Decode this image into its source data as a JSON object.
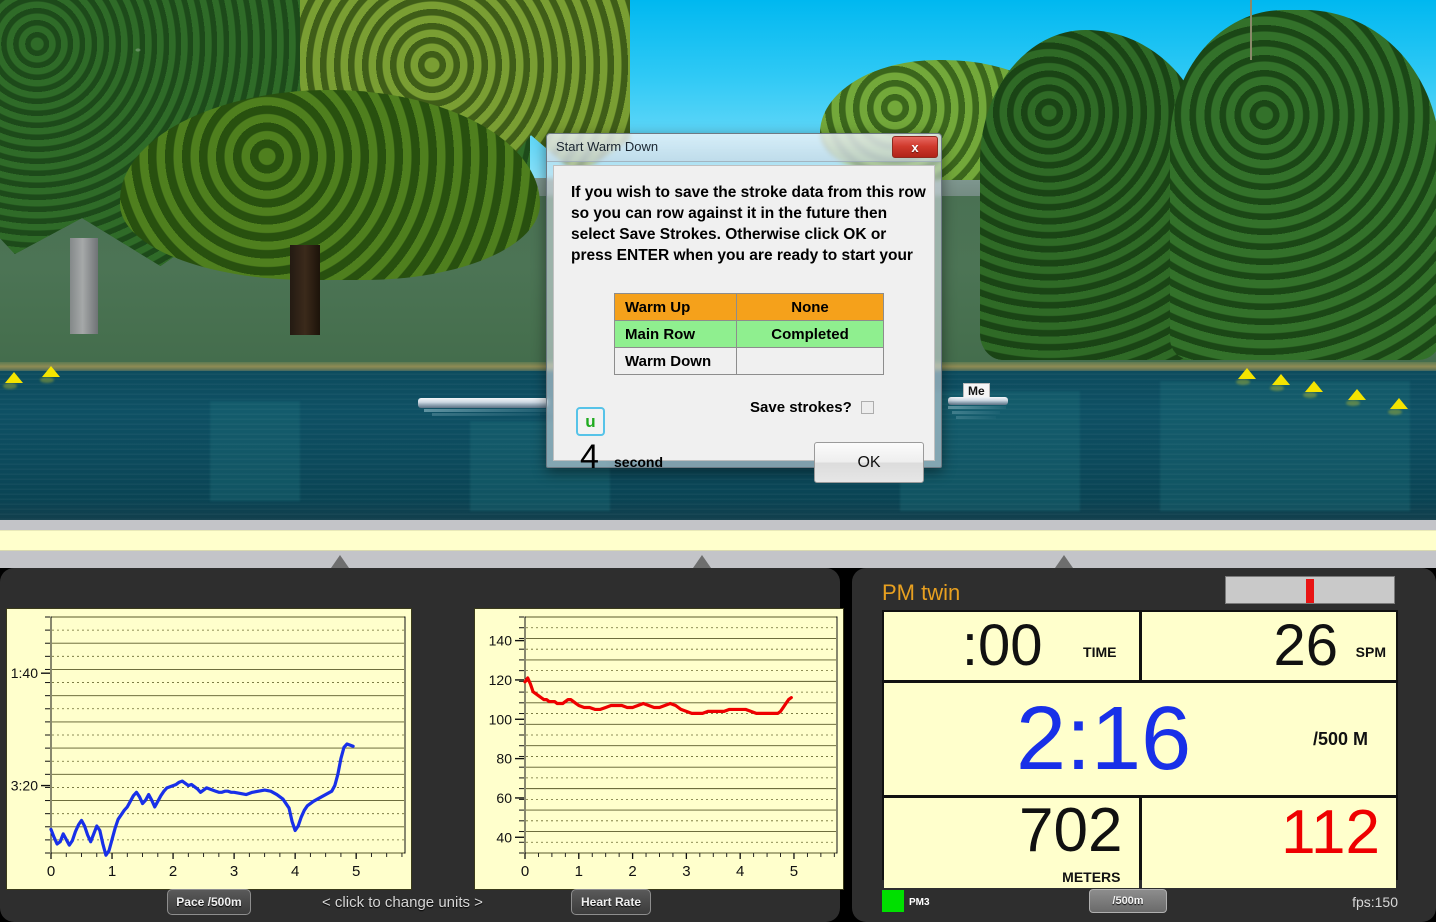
{
  "scene": {
    "boats": [
      {
        "name": "opponent-boat",
        "label": ""
      },
      {
        "name": "my-boat",
        "label": "Me"
      }
    ]
  },
  "dialog": {
    "title": "Start Warm Down",
    "close_label": "x",
    "message": "If you wish to save the stroke data from this row so you can row against it in the future then select Save Strokes.  Otherwise click OK or press ENTER when you are ready to start your",
    "status_rows": [
      {
        "label": "Warm Up",
        "value": "None"
      },
      {
        "label": "Main Row",
        "value": "Completed"
      },
      {
        "label": "Warm Down",
        "value": ""
      }
    ],
    "save_strokes_label": "Save strokes?",
    "save_strokes_checked": false,
    "units_button_label": "u",
    "countdown_value": "4",
    "countdown_unit": "second",
    "ok_label": "OK"
  },
  "left_panel": {
    "pace_button": "Pace /500m",
    "hint": "<  click to change units  >",
    "hr_button": "Heart Rate"
  },
  "monitor": {
    "title": "PM twin",
    "time_value": ":00",
    "time_unit": "TIME",
    "spm_value": "26",
    "spm_unit": "SPM",
    "pace_value": "2:16",
    "pace_unit": "/500 M",
    "meters_value": "702",
    "meters_unit": "METERS",
    "heart_rate_value": "112",
    "device_label": "PM3",
    "units_button": "/500m",
    "fps": "fps:150",
    "colors": {
      "pace": "#1830e8",
      "heart_rate": "#ee0000",
      "title": "#e8a020",
      "screen": "#ffffcc",
      "led": "#00e000",
      "indicator": "#e81414"
    }
  },
  "chart_data": [
    {
      "type": "line",
      "name": "pace-chart",
      "title": "",
      "xlabel": "",
      "ylabel": "Pace /500m",
      "series_color": "#1830e8",
      "xlim": [
        0,
        5.8
      ],
      "xticks": [
        0,
        1,
        2,
        3,
        4,
        5
      ],
      "xticklabels": [
        "0",
        "1",
        "2",
        "3",
        "4",
        "5"
      ],
      "ylim_labels": [
        "1:40",
        "3:20"
      ],
      "yticks_labeled": [
        100,
        200
      ],
      "ylim": [
        50,
        260
      ],
      "y_inverted": true,
      "grid": true,
      "x": [
        0.0,
        0.05,
        0.1,
        0.15,
        0.2,
        0.25,
        0.3,
        0.35,
        0.4,
        0.45,
        0.5,
        0.55,
        0.6,
        0.65,
        0.7,
        0.75,
        0.8,
        0.85,
        0.9,
        0.95,
        1.0,
        1.05,
        1.1,
        1.15,
        1.2,
        1.25,
        1.3,
        1.35,
        1.4,
        1.45,
        1.5,
        1.55,
        1.6,
        1.65,
        1.7,
        1.75,
        1.8,
        1.85,
        1.9,
        1.95,
        2.0,
        2.05,
        2.1,
        2.15,
        2.2,
        2.25,
        2.3,
        2.35,
        2.4,
        2.45,
        2.5,
        2.55,
        2.6,
        2.65,
        2.7,
        2.75,
        2.8,
        2.85,
        2.9,
        2.95,
        3.0,
        3.1,
        3.2,
        3.3,
        3.4,
        3.5,
        3.6,
        3.7,
        3.8,
        3.9,
        3.95,
        4.0,
        4.05,
        4.1,
        4.15,
        4.2,
        4.3,
        4.4,
        4.5,
        4.6,
        4.65,
        4.7,
        4.75,
        4.8,
        4.85,
        4.9,
        4.95
      ],
      "y": [
        239,
        246,
        252,
        250,
        243,
        248,
        253,
        249,
        241,
        235,
        231,
        236,
        244,
        250,
        243,
        236,
        240,
        252,
        262,
        258,
        248,
        238,
        230,
        226,
        222,
        219,
        214,
        209,
        206,
        210,
        216,
        213,
        208,
        213,
        219,
        214,
        209,
        205,
        202,
        201,
        200,
        199,
        197,
        196,
        198,
        200,
        199,
        201,
        203,
        206,
        204,
        202,
        203,
        204,
        205,
        206,
        206,
        205,
        205,
        206,
        206,
        207,
        208,
        206,
        205,
        204,
        205,
        208,
        212,
        220,
        232,
        240,
        236,
        228,
        222,
        218,
        214,
        211,
        208,
        205,
        200,
        190,
        176,
        166,
        163,
        164,
        165
      ],
      "values_unit": "seconds per 500m"
    },
    {
      "type": "line",
      "name": "heart-rate-chart",
      "title": "",
      "xlabel": "",
      "ylabel": "Heart Rate",
      "series_color": "#ee0000",
      "xlim": [
        0,
        5.8
      ],
      "xticks": [
        0,
        1,
        2,
        3,
        4,
        5
      ],
      "xticklabels": [
        "0",
        "1",
        "2",
        "3",
        "4",
        "5"
      ],
      "ylim": [
        32,
        152
      ],
      "yticks": [
        40,
        60,
        80,
        100,
        120,
        140
      ],
      "yticklabels": [
        "40",
        "60",
        "80",
        "100",
        "120",
        "140"
      ],
      "grid": true,
      "x": [
        0.0,
        0.05,
        0.1,
        0.15,
        0.2,
        0.25,
        0.3,
        0.35,
        0.4,
        0.45,
        0.5,
        0.55,
        0.6,
        0.65,
        0.7,
        0.75,
        0.8,
        0.85,
        0.9,
        0.95,
        1.0,
        1.1,
        1.2,
        1.3,
        1.4,
        1.5,
        1.6,
        1.7,
        1.8,
        1.9,
        2.0,
        2.1,
        2.2,
        2.3,
        2.4,
        2.5,
        2.6,
        2.7,
        2.8,
        2.9,
        3.0,
        3.1,
        3.2,
        3.3,
        3.4,
        3.5,
        3.6,
        3.7,
        3.8,
        3.9,
        4.0,
        4.1,
        4.2,
        4.3,
        4.4,
        4.5,
        4.6,
        4.7,
        4.75,
        4.8,
        4.85,
        4.9,
        4.95
      ],
      "y": [
        119,
        121,
        118,
        114,
        113,
        112,
        111,
        110,
        110,
        109,
        109,
        109,
        108,
        108,
        108,
        109,
        110,
        110,
        109,
        108,
        107,
        106,
        106,
        105,
        105,
        106,
        107,
        107,
        107,
        106,
        106,
        107,
        108,
        107,
        106,
        106,
        107,
        108,
        107,
        105,
        104,
        103,
        103,
        103,
        104,
        104,
        104,
        104,
        105,
        105,
        105,
        105,
        104,
        103,
        103,
        103,
        103,
        103,
        104,
        106,
        108,
        110,
        111
      ],
      "values_unit": "bpm"
    }
  ]
}
